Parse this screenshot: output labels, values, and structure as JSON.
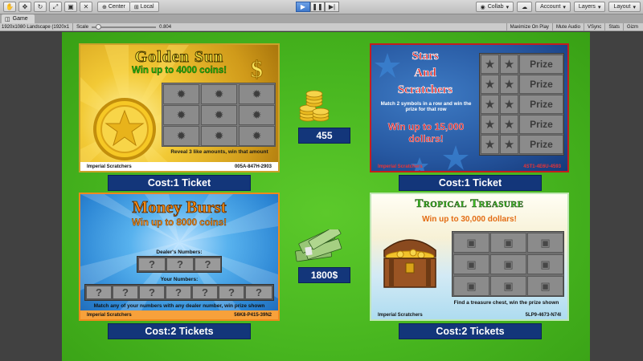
{
  "editor": {
    "toolbar": {
      "tool_icons": [
        "hand-icon",
        "move-icon",
        "rotate-icon",
        "scale-icon",
        "rect-icon",
        "transform-icon"
      ],
      "center_label": "Center",
      "local_label": "Local",
      "collab_label": "Collab",
      "account_label": "Account",
      "layers_label": "Layers",
      "layout_label": "Layout"
    },
    "tab_label": "Game",
    "gamebar": {
      "resolution": "1920x1080 Landscape (1920x1",
      "scale_label": "Scale",
      "scale_value": "0.804",
      "maximize_label": "Maximize On Play",
      "mute_label": "Mute Audio",
      "vsync_label": "VSync",
      "stats_label": "Stats",
      "gizmos_label": "Gizm"
    }
  },
  "game": {
    "colors": {
      "background": "#47b51f",
      "badge": "#13367a"
    },
    "coins_value": "455",
    "cash_value": "1800$",
    "cards": [
      {
        "title": "Golden Sun",
        "subtitle": "Win up to 4000 coins!",
        "instructions": "Reveal 3 like amounts, win that amount",
        "brand": "Imperial Scratchers",
        "serial": "005A-847H-2903",
        "cost": "Cost:1 Ticket"
      },
      {
        "title_lines": [
          "Stars",
          "And",
          "Scratchers"
        ],
        "instructions": "Match 2 symbols in a row and win the prize for that row",
        "win_text": "Win up to 15,000 dollars!",
        "prize_label": "Prize",
        "brand": "Imperial Scratchers",
        "serial": "4ST1-4E6U-4593",
        "cost": "Cost:1 Ticket"
      },
      {
        "title": "Money Burst",
        "subtitle": "Win up to 8000 coins!",
        "dealer_label": "Dealer's Numbers:",
        "your_label": "Your Numbers:",
        "hidden_symbol": "?",
        "instructions": "Match any of your numbers with any dealer number, win prize shown",
        "brand": "Imperial Scratchers",
        "serial": "56K8-P415-39N2",
        "cost": "Cost:2 Tickets"
      },
      {
        "title": "Tropical Treasure",
        "subtitle": "Win up to 30,000 dollars!",
        "instructions": "Find a treasure chest, win the prize shown",
        "brand": "Imperial Scratchers",
        "serial": "5LP9-4673-N74I",
        "cost": "Cost:2 Tickets"
      }
    ]
  }
}
